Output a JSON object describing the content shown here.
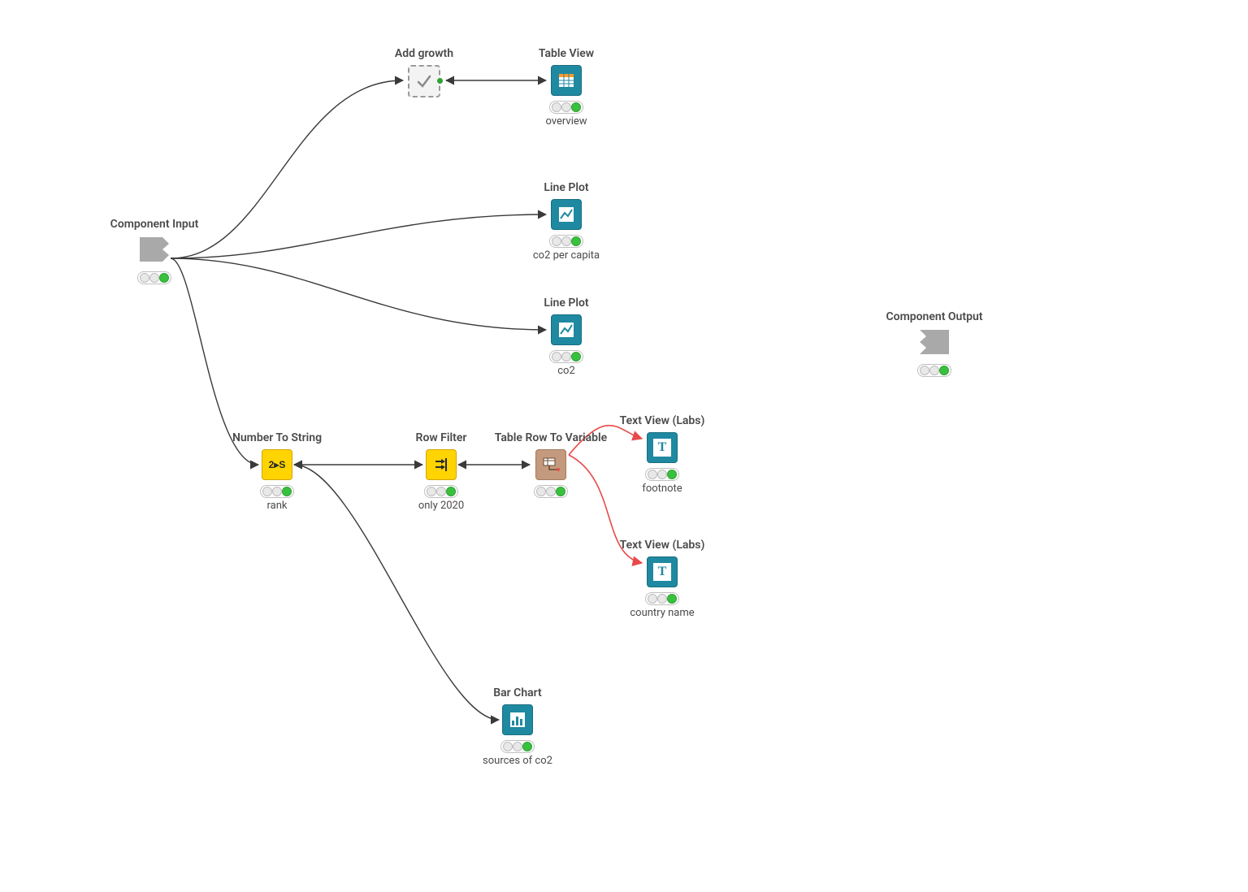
{
  "nodes": {
    "componentInput": {
      "title": "Component Input",
      "sub": ""
    },
    "addGrowth": {
      "title": "Add growth",
      "sub": ""
    },
    "tableView": {
      "title": "Table View",
      "sub": "overview"
    },
    "linePlot1": {
      "title": "Line Plot",
      "sub": "co2 per capita"
    },
    "linePlot2": {
      "title": "Line Plot",
      "sub": "co2"
    },
    "numberToString": {
      "title": "Number To String",
      "sub": "rank"
    },
    "rowFilter": {
      "title": "Row Filter",
      "sub": "only 2020"
    },
    "tableRowToVar": {
      "title": "Table Row To Variable",
      "sub": ""
    },
    "textView1": {
      "title": "Text View (Labs)",
      "sub": "footnote"
    },
    "textView2": {
      "title": "Text View (Labs)",
      "sub": "country name"
    },
    "barChart": {
      "title": "Bar Chart",
      "sub": "sources of co2"
    },
    "componentOutput": {
      "title": "Component Output",
      "sub": ""
    }
  }
}
